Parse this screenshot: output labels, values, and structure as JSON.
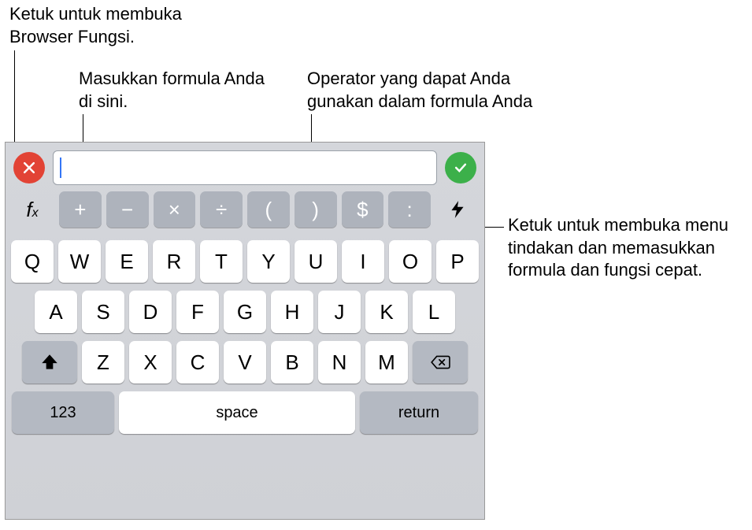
{
  "callouts": {
    "fx": "Ketuk untuk membuka Browser Fungsi.",
    "input": "Masukkan formula Anda di sini.",
    "ops": "Operator yang dapat Anda gunakan dalam formula Anda",
    "bolt": "Ketuk untuk membuka menu tindakan dan memasukkan formula dan fungsi cepat."
  },
  "formula_bar": {
    "value": "",
    "fx_label": "f",
    "fx_sub": "x"
  },
  "operators": [
    "+",
    "−",
    "×",
    "÷",
    "(",
    ")",
    "$",
    ":"
  ],
  "keyboard": {
    "row1": [
      "Q",
      "W",
      "E",
      "R",
      "T",
      "Y",
      "U",
      "I",
      "O",
      "P"
    ],
    "row2": [
      "A",
      "S",
      "D",
      "F",
      "G",
      "H",
      "J",
      "K",
      "L"
    ],
    "row3": [
      "Z",
      "X",
      "C",
      "V",
      "B",
      "N",
      "M"
    ],
    "numswitch": "123",
    "space": "space",
    "return": "return"
  }
}
